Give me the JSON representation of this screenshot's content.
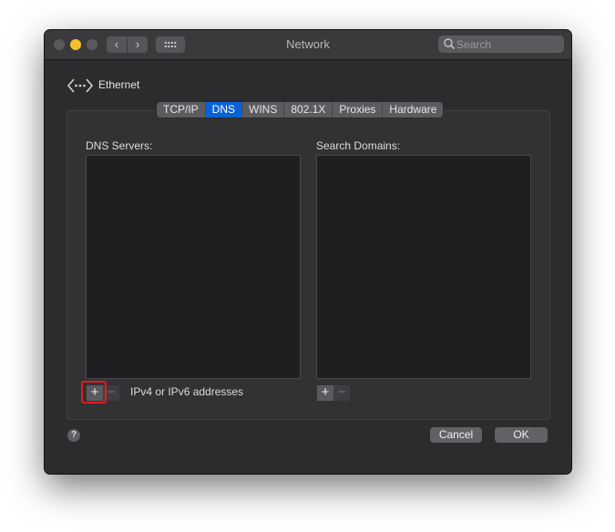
{
  "window": {
    "title": "Network",
    "search_placeholder": "Search"
  },
  "interface": {
    "name": "Ethernet",
    "icon": "ethernet-icon"
  },
  "tabs": [
    {
      "label": "TCP/IP",
      "active": false
    },
    {
      "label": "DNS",
      "active": true
    },
    {
      "label": "WINS",
      "active": false
    },
    {
      "label": "802.1X",
      "active": false
    },
    {
      "label": "Proxies",
      "active": false
    },
    {
      "label": "Hardware",
      "active": false
    }
  ],
  "dns": {
    "servers_label": "DNS Servers:",
    "domains_label": "Search Domains:",
    "add_symbol": "+",
    "remove_symbol": "−",
    "hint": "IPv4 or IPv6 addresses"
  },
  "footer": {
    "help_symbol": "?",
    "cancel_label": "Cancel",
    "ok_label": "OK"
  },
  "colors": {
    "accent": "#0a63d6",
    "highlight": "#e41b23",
    "window_bg": "#2c2c2e"
  }
}
